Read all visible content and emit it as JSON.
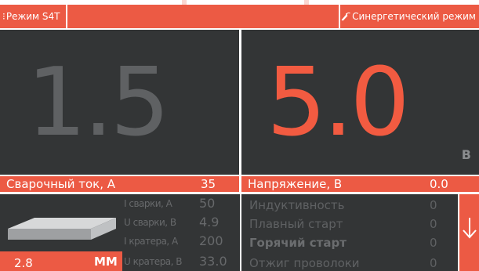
{
  "header": {
    "mode_label": "Режим S4T",
    "synergic_label": "Синергетический режим"
  },
  "main": {
    "current_value": "1.5",
    "voltage_value": "5.0",
    "voltage_unit": "В"
  },
  "labels": {
    "current_label": "Сварочный ток, А",
    "current_set": "35",
    "voltage_label": "Напряжение, В",
    "voltage_set": "0.0"
  },
  "wire": {
    "diameter": "2.8",
    "unit": "ММ"
  },
  "mid_params": [
    {
      "label": "I сварки, А",
      "value": "50"
    },
    {
      "label": "U сварки, В",
      "value": "4.9"
    },
    {
      "label": "I кратера, А",
      "value": "200"
    },
    {
      "label": "U кратера, В",
      "value": "33.0"
    }
  ],
  "right_params": [
    {
      "label": "Индуктивность",
      "value": "0"
    },
    {
      "label": "Плавный старт",
      "value": "0"
    },
    {
      "label": "Горячий старт",
      "value": "0"
    },
    {
      "label": "Отжиг проволоки",
      "value": "0"
    }
  ],
  "colors": {
    "accent": "#ec5a44",
    "panel": "#333536",
    "dim_text": "#5f6163"
  },
  "icons": {
    "mode": "mode-icon",
    "torch": "torch-icon",
    "scroll": "arrow-down-icon"
  }
}
